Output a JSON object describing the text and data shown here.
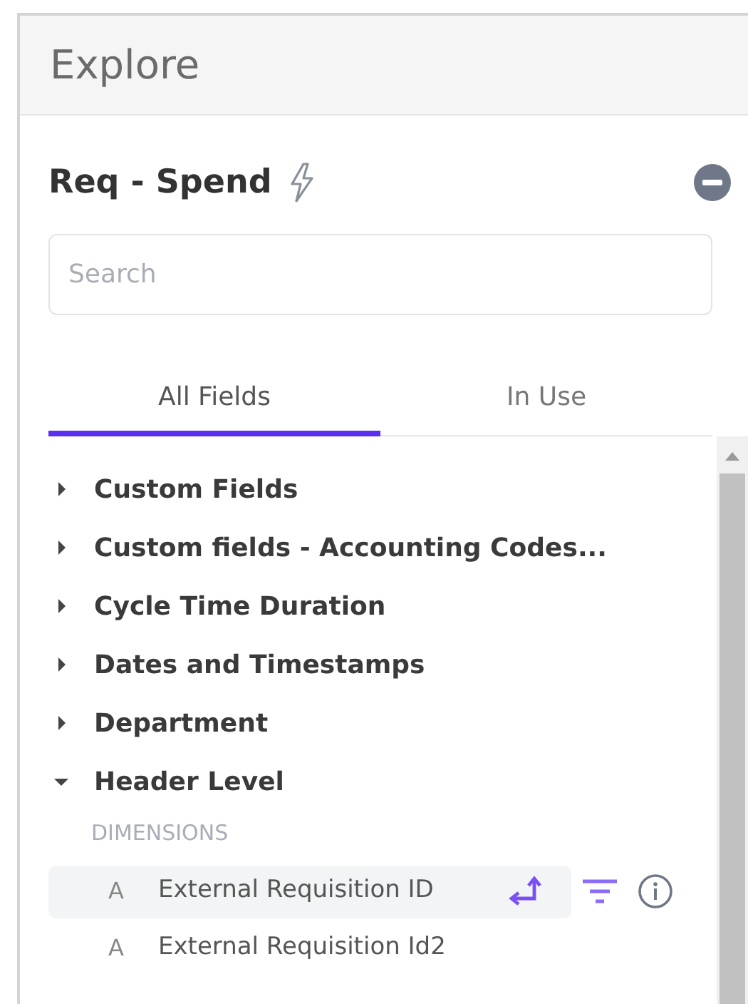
{
  "panel": {
    "title": "Explore"
  },
  "explore": {
    "name": "Req - Spend"
  },
  "search": {
    "placeholder": "Search"
  },
  "tabs": [
    {
      "label": "All Fields",
      "selected": true
    },
    {
      "label": "In Use",
      "selected": false
    }
  ],
  "groups": [
    {
      "label": "Custom Fields",
      "expanded": false
    },
    {
      "label": "Custom fields - Accounting Codes...",
      "expanded": false
    },
    {
      "label": "Cycle Time Duration",
      "expanded": false
    },
    {
      "label": "Dates and Timestamps",
      "expanded": false
    },
    {
      "label": "Department",
      "expanded": false
    },
    {
      "label": "Header Level",
      "expanded": true,
      "section": "DIMENSIONS",
      "children": [
        {
          "type": "A",
          "label": "External Requisition ID",
          "highlighted": true
        },
        {
          "type": "A",
          "label": "External Requisition Id2",
          "highlighted": false
        }
      ]
    }
  ]
}
